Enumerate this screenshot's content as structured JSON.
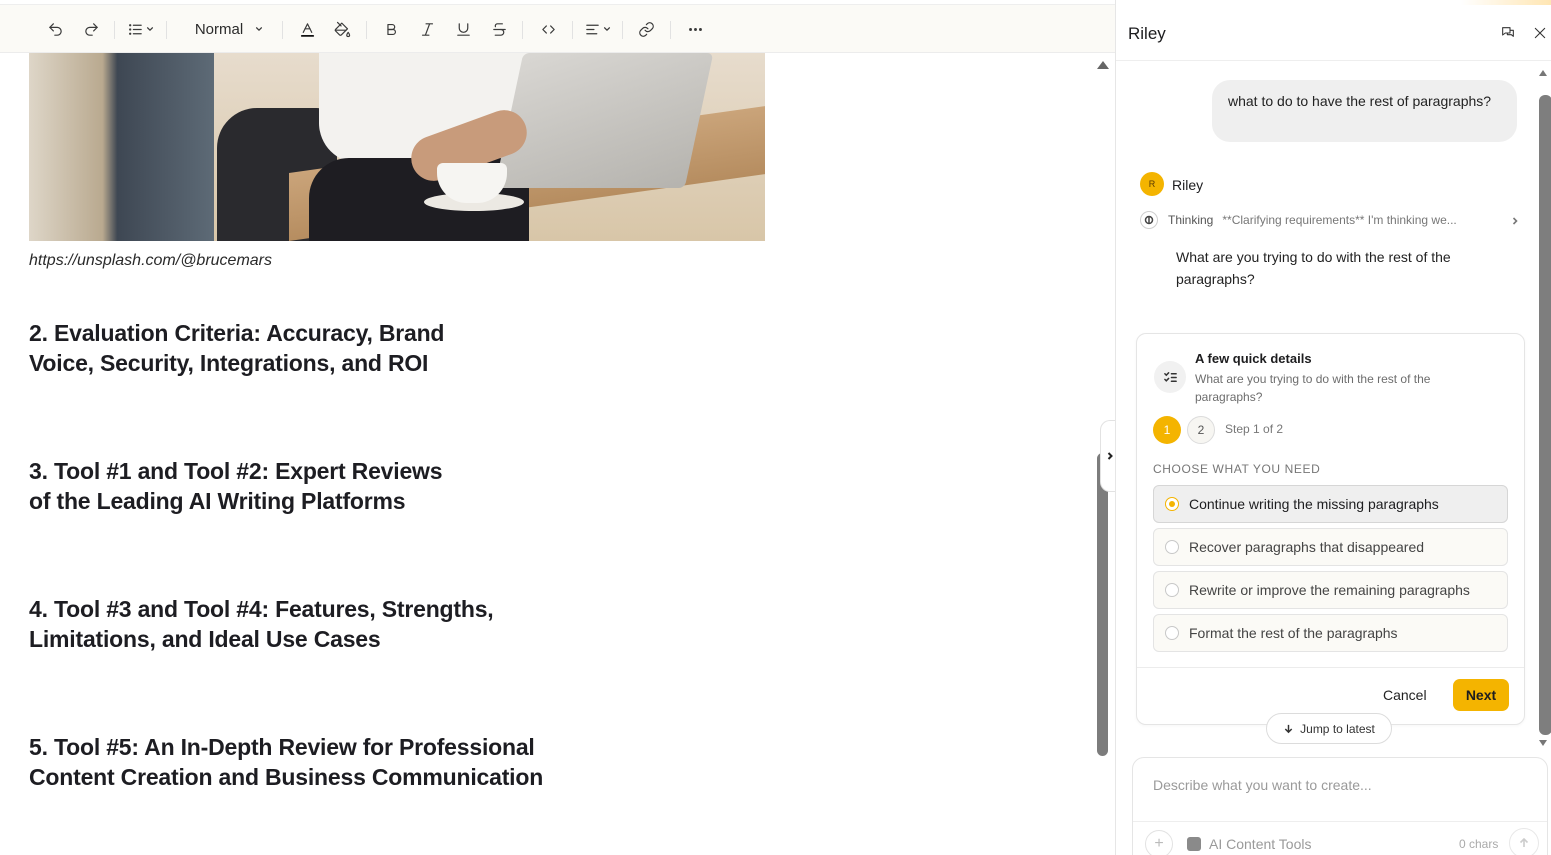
{
  "editor": {
    "toolbar": {
      "undo_icon": "undo-icon",
      "redo_icon": "redo-icon",
      "list_icon": "bullet-list-icon",
      "text_style": "Normal",
      "text_color_icon": "text-color-icon",
      "highlight_icon": "paint-bucket-icon",
      "bold_icon": "bold-icon",
      "italic_icon": "italic-icon",
      "underline_icon": "underline-icon",
      "strike_icon": "strikethrough-icon",
      "code_icon": "code-icon",
      "align_icon": "align-left-icon",
      "link_icon": "link-icon",
      "more_icon": "more-icon"
    },
    "image_caption": "https://unsplash.com/@brucemars",
    "headings": [
      {
        "line1": "2. Evaluation Criteria: Accuracy, Brand",
        "line2": "Voice, Security, Integrations, and ROI"
      },
      {
        "line1": "3. Tool #1 and Tool #2: Expert Reviews",
        "line2": "of the Leading AI Writing Platforms"
      },
      {
        "line1": "4. Tool #3 and Tool #4: Features, Strengths,",
        "line2": "Limitations, and Ideal Use Cases"
      },
      {
        "line1": "5. Tool #5: An In-Depth Review for Professional",
        "line2": "Content Creation and Business Communication"
      }
    ]
  },
  "panel": {
    "title": "Riley",
    "user_message": "what to do to have  the rest of paragraphs?",
    "bot": {
      "avatar_letter": "R",
      "name": "Riley",
      "thinking_label": "Thinking",
      "thinking_snippet": "**Clarifying requirements** I'm thinking we...",
      "message": "What are you trying to do with the rest of the paragraphs?"
    },
    "card": {
      "title": "A few quick details",
      "subtitle": "What are you trying to do with the rest of the paragraphs?",
      "step_1": "1",
      "step_2": "2",
      "step_text": "Step 1 of 2",
      "section_label": "CHOOSE WHAT YOU NEED",
      "options": [
        {
          "label": "Continue writing the missing paragraphs",
          "selected": true
        },
        {
          "label": "Recover paragraphs that disappeared",
          "selected": false
        },
        {
          "label": "Rewrite or improve the remaining paragraphs",
          "selected": false
        },
        {
          "label": "Format the rest of the paragraphs",
          "selected": false
        }
      ],
      "cancel_label": "Cancel",
      "next_label": "Next"
    },
    "jump_label": "Jump to latest",
    "composer": {
      "placeholder": "Describe what you want to create...",
      "tools_label": "AI Content Tools",
      "char_count": "0 chars"
    }
  },
  "colors": {
    "accent": "#f4b400",
    "toolbar_bg": "#fbfaf6"
  }
}
